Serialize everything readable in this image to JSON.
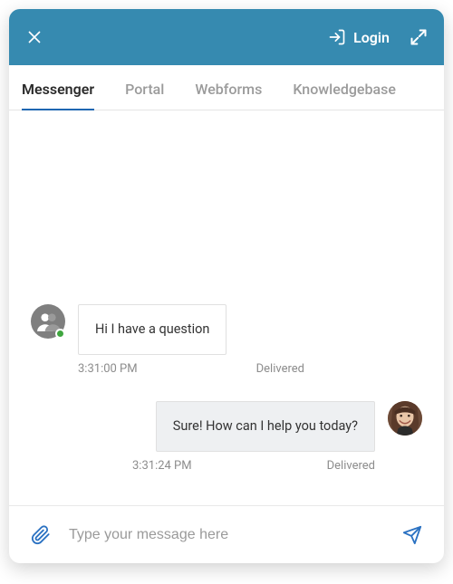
{
  "header": {
    "login_label": "Login"
  },
  "tabs": [
    {
      "label": "Messenger",
      "active": true
    },
    {
      "label": "Portal",
      "active": false
    },
    {
      "label": "Webforms",
      "active": false
    },
    {
      "label": "Knowledgebase",
      "active": false
    }
  ],
  "messages": [
    {
      "side": "left",
      "author": "guest",
      "text": "Hi I have a question",
      "time": "3:31:00 PM",
      "status": "Delivered"
    },
    {
      "side": "right",
      "author": "agent",
      "text": "Sure! How can I help you today?",
      "time": "3:31:24 PM",
      "status": "Delivered"
    }
  ],
  "composer": {
    "placeholder": "Type your message here",
    "value": ""
  },
  "colors": {
    "header_bg": "#368AB0",
    "accent": "#2b72c2",
    "presence_online": "#3fa63f"
  }
}
